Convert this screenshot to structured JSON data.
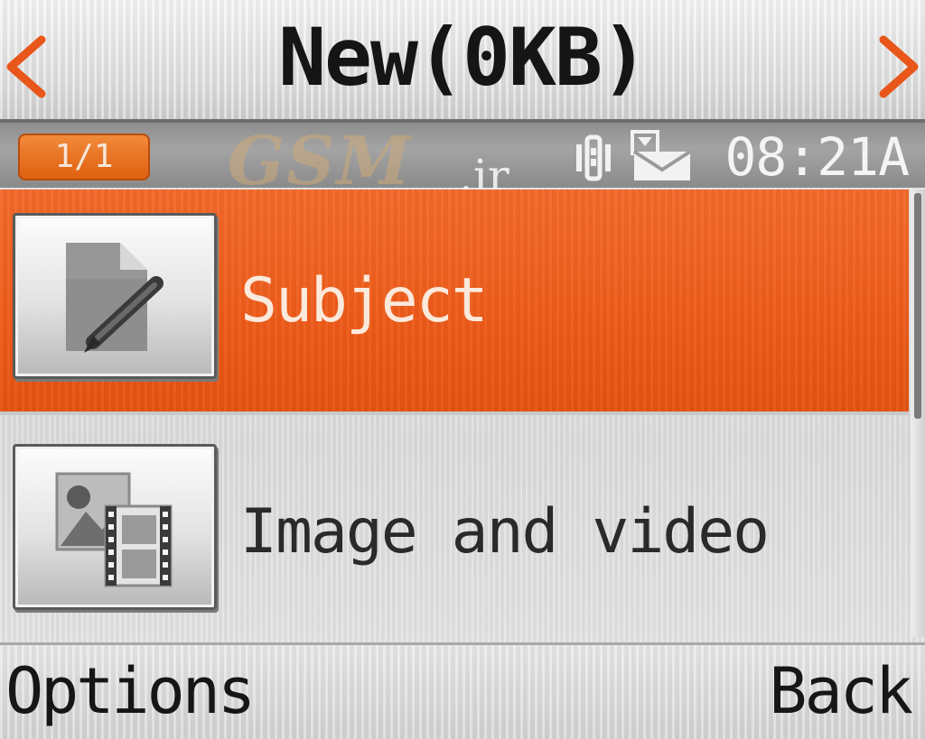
{
  "title_bar": {
    "title": "New(0KB)",
    "left_arrow_icon": "chevron-left-icon",
    "right_arrow_icon": "chevron-right-icon",
    "arrow_color": "#e8561a"
  },
  "status_bar": {
    "page_indicator": "1/1",
    "watermark": "GSM",
    "watermark_suffix": ".ir",
    "signal_icon": "signal-icon",
    "message_icon": "message-envelope-icon",
    "time": "08:21A"
  },
  "list": {
    "selected_color": "#ec5a18",
    "items": [
      {
        "label": "Subject",
        "icon": "edit-document-icon",
        "selected": true
      },
      {
        "label": "Image and video",
        "icon": "image-video-icon",
        "selected": false
      }
    ]
  },
  "softkeys": {
    "left": "Options",
    "right": "Back"
  }
}
